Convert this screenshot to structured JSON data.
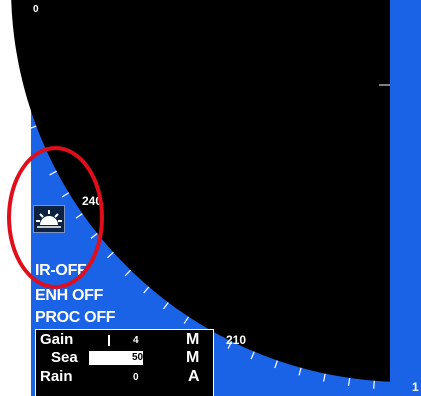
{
  "bearing_scale": {
    "label_top": "0",
    "label_240": "240",
    "label_210": "210",
    "label_bottom_right": "1"
  },
  "status": {
    "ir": "IR-OFF",
    "enh": "ENH OFF",
    "proc": "PROC OFF"
  },
  "controls": {
    "gain": {
      "label": "Gain",
      "value": "4",
      "mode": "M"
    },
    "sea": {
      "label": "Sea",
      "value": "50",
      "mode": "M",
      "level": 0.5
    },
    "rain": {
      "label": "Rain",
      "value": "0",
      "mode": "A"
    }
  },
  "icons": {
    "sun": "day-night-sun-icon",
    "highlight": "annotation-circle"
  },
  "colors": {
    "background": "#1b63e6",
    "radar": "#000000",
    "text": "#ffffff",
    "annotation": "#e00d1a"
  }
}
